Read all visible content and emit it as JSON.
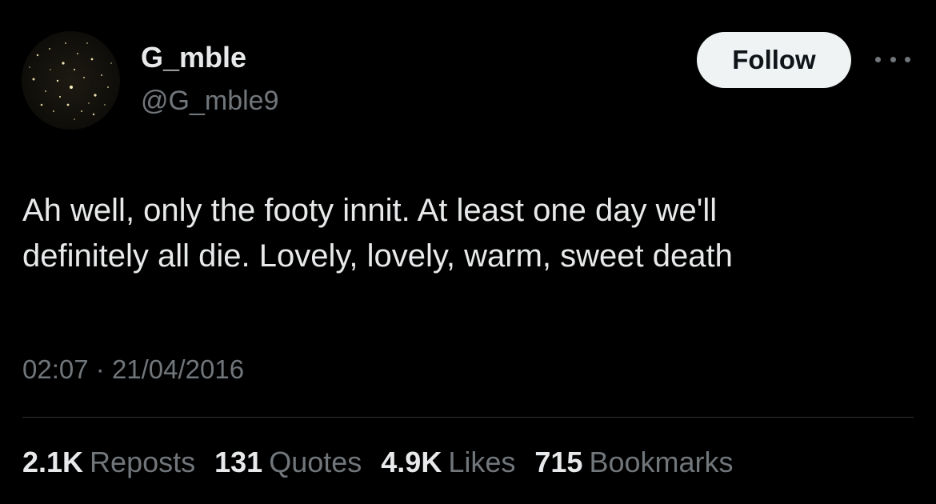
{
  "author": {
    "name": "G_mble",
    "handle": "@G_mble9"
  },
  "follow_label": "Follow",
  "more_icon": "more-horizontal-icon",
  "tweet": {
    "lines": [
      "Ah well, only the footy innit. At least one day we'll",
      "definitely all die. Lovely, lovely, warm, sweet death"
    ],
    "time": "02:07",
    "separator": "·",
    "date": "21/04/2016"
  },
  "stats": [
    {
      "value": "2.1K",
      "label": "Reposts"
    },
    {
      "value": "131",
      "label": "Quotes"
    },
    {
      "value": "4.9K",
      "label": "Likes"
    },
    {
      "value": "715",
      "label": "Bookmarks"
    }
  ],
  "colors": {
    "background": "#000000",
    "primary_text": "#e7e9ea",
    "secondary_text": "#71767b",
    "follow_button_bg": "#eff3f4",
    "follow_button_text": "#0f1419",
    "divider": "#2f3336"
  }
}
